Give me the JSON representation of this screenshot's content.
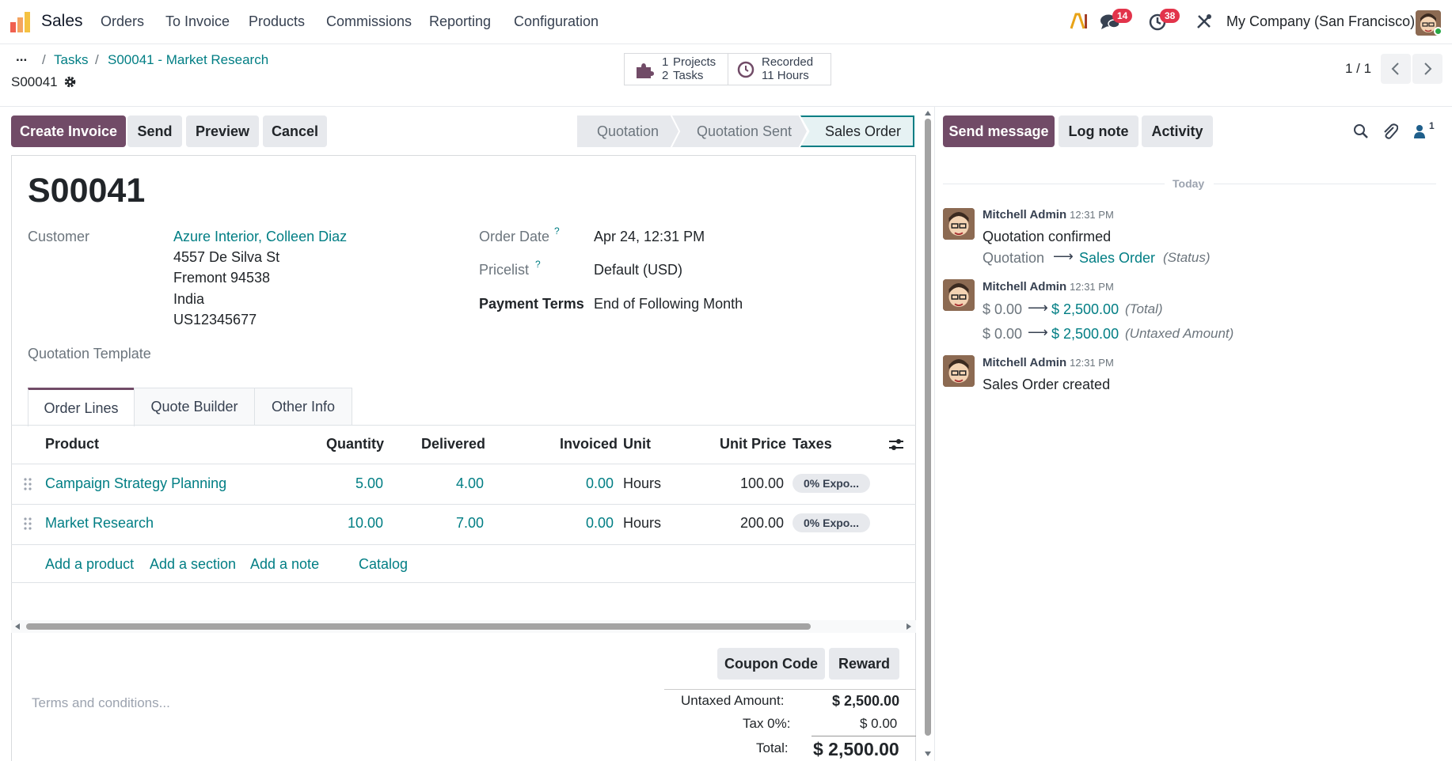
{
  "navbar": {
    "app_name": "Sales",
    "menu": [
      "Orders",
      "To Invoice",
      "Products",
      "Commissions",
      "Reporting",
      "Configuration"
    ],
    "messages_count": "14",
    "activities_count": "38",
    "company": "My Company (San Francisco)"
  },
  "breadcrumb": {
    "ellipsis": "...",
    "items": [
      "Tasks",
      "S00041 - Market Research"
    ],
    "record_name": "S00041"
  },
  "smart_buttons": {
    "projects": {
      "count": "1",
      "label": "Projects",
      "count2": "2",
      "label2": "Tasks"
    },
    "recorded": {
      "label": "Recorded",
      "value": "11 Hours"
    }
  },
  "pager": {
    "value": "1 / 1"
  },
  "actions": {
    "create_invoice": "Create Invoice",
    "send": "Send",
    "preview": "Preview",
    "cancel": "Cancel"
  },
  "statusbar": {
    "stages": [
      "Quotation",
      "Quotation Sent",
      "Sales Order"
    ],
    "active": "Sales Order"
  },
  "form": {
    "title": "S00041",
    "customer_label": "Customer",
    "customer_name": "Azure Interior, Colleen Diaz",
    "address": [
      "4557 De Silva St",
      "Fremont 94538",
      "India",
      "US12345677"
    ],
    "quotation_template_label": "Quotation Template",
    "order_date_label": "Order Date",
    "order_date": "Apr 24, 12:31 PM",
    "pricelist_label": "Pricelist",
    "pricelist": "Default (USD)",
    "payment_terms_label": "Payment Terms",
    "payment_terms": "End of Following Month",
    "help_mark": "?"
  },
  "tabs": [
    "Order Lines",
    "Quote Builder",
    "Other Info"
  ],
  "order_lines": {
    "headers": {
      "product": "Product",
      "quantity": "Quantity",
      "delivered": "Delivered",
      "invoiced": "Invoiced",
      "unit": "Unit",
      "unit_price": "Unit Price",
      "taxes": "Taxes"
    },
    "rows": [
      {
        "product": "Campaign Strategy Planning",
        "quantity": "5.00",
        "delivered": "4.00",
        "invoiced": "0.00",
        "unit": "Hours",
        "unit_price": "100.00",
        "tax": "0% Expo..."
      },
      {
        "product": "Market Research",
        "quantity": "10.00",
        "delivered": "7.00",
        "invoiced": "0.00",
        "unit": "Hours",
        "unit_price": "200.00",
        "tax": "0% Expo..."
      }
    ],
    "add_product": "Add a product",
    "add_section": "Add a section",
    "add_note": "Add a note",
    "catalog": "Catalog"
  },
  "footer": {
    "coupon_code": "Coupon Code",
    "reward": "Reward",
    "terms_placeholder": "Terms and conditions...",
    "untaxed_label": "Untaxed Amount:",
    "untaxed_value": "$ 2,500.00",
    "tax_label": "Tax 0%:",
    "tax_value": "$ 0.00",
    "total_label": "Total:",
    "total_value": "$ 2,500.00"
  },
  "chatter": {
    "send_message": "Send message",
    "log_note": "Log note",
    "activity": "Activity",
    "followers_count": "1",
    "date_separator": "Today",
    "messages": [
      {
        "author": "Mitchell Admin",
        "time": "12:31 PM",
        "text": "Quotation confirmed",
        "from": "Quotation",
        "to": "Sales Order",
        "field": "(Status)"
      },
      {
        "author": "Mitchell Admin",
        "time": "12:31 PM",
        "changes": [
          {
            "from": "$ 0.00",
            "to": "$ 2,500.00",
            "field": "(Total)"
          },
          {
            "from": "$ 0.00",
            "to": "$ 2,500.00",
            "field": "(Untaxed Amount)"
          }
        ]
      },
      {
        "author": "Mitchell Admin",
        "time": "12:31 PM",
        "text": "Sales Order created"
      }
    ]
  },
  "colors": {
    "primary": "#714b67",
    "link": "#017e84",
    "badge": "#e2344b"
  }
}
